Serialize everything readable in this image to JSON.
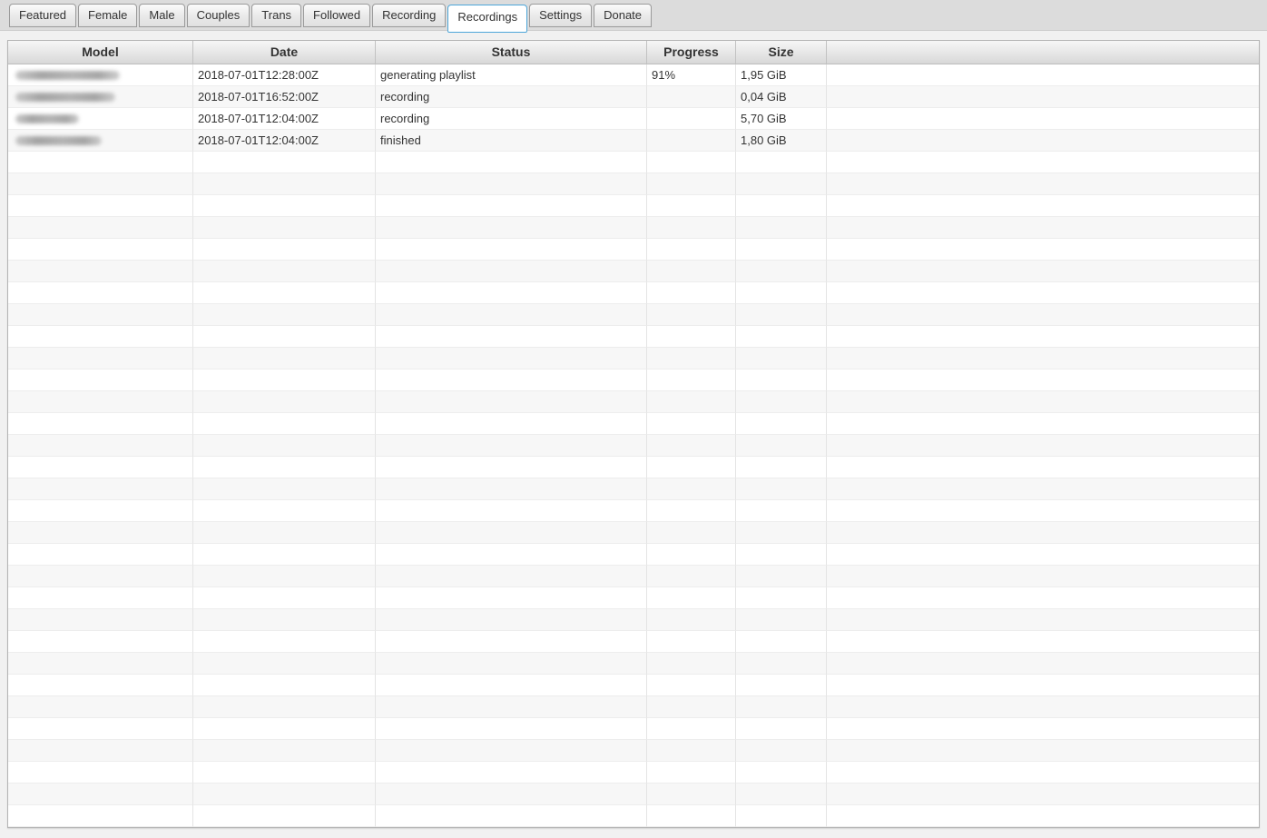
{
  "tab_bar": {
    "selected_tab": "Recordings",
    "tabs": [
      {
        "label": "Featured"
      },
      {
        "label": "Female"
      },
      {
        "label": "Male"
      },
      {
        "label": "Couples"
      },
      {
        "label": "Trans"
      },
      {
        "label": "Followed"
      },
      {
        "label": "Recording"
      },
      {
        "label": "Recordings"
      },
      {
        "label": "Settings"
      },
      {
        "label": "Donate"
      }
    ]
  },
  "recordings_table": {
    "columns": [
      {
        "label": "Model"
      },
      {
        "label": "Date"
      },
      {
        "label": "Status"
      },
      {
        "label": "Progress"
      },
      {
        "label": "Size"
      },
      {
        "label": ""
      }
    ],
    "rows": [
      {
        "model_redacted": true,
        "redact_width": 115,
        "date": "2018-07-01T12:28:00Z",
        "status": "generating playlist",
        "progress": "91%",
        "size": "1,95 GiB"
      },
      {
        "model_redacted": true,
        "redact_width": 110,
        "date": "2018-07-01T16:52:00Z",
        "status": "recording",
        "progress": "",
        "size": "0,04 GiB"
      },
      {
        "model_redacted": true,
        "redact_width": 70,
        "date": "2018-07-01T12:04:00Z",
        "status": "recording",
        "progress": "",
        "size": "5,70 GiB"
      },
      {
        "model_redacted": true,
        "redact_width": 95,
        "date": "2018-07-01T12:04:00Z",
        "status": "finished",
        "progress": "",
        "size": "1,80 GiB"
      }
    ],
    "empty_row_count": 31
  },
  "colors": {
    "selected_tab_border": "#4da6d9",
    "row_stripe": "#f7f7f7",
    "header_text": "#333333",
    "cell_text": "#333333",
    "tab_strip_background": "#dcdcdc",
    "page_background": "#f1f1f1"
  }
}
